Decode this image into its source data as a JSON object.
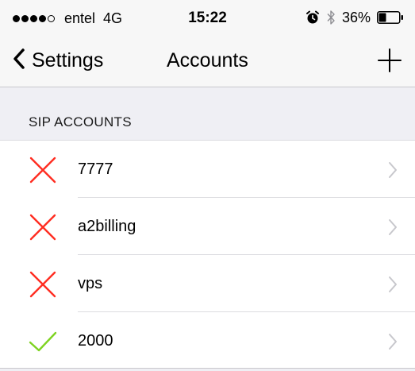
{
  "status_bar": {
    "carrier": "entel",
    "network": "4G",
    "time": "15:22",
    "battery": "36%",
    "battery_level": 0.36,
    "signal_bars_filled": 4,
    "signal_bars_total": 5,
    "icons": [
      "signal-icon",
      "alarm-icon",
      "bluetooth-icon",
      "battery-icon"
    ]
  },
  "nav": {
    "back_label": "Settings",
    "title": "Accounts",
    "add_icon": "plus-icon"
  },
  "section": {
    "title": "SIP ACCOUNTS"
  },
  "accounts": [
    {
      "label": "7777",
      "status": "error",
      "status_icon": "cross-icon"
    },
    {
      "label": "a2billing",
      "status": "error",
      "status_icon": "cross-icon"
    },
    {
      "label": "vps",
      "status": "error",
      "status_icon": "cross-icon"
    },
    {
      "label": "2000",
      "status": "ok",
      "status_icon": "check-icon"
    }
  ],
  "colors": {
    "error": "#ff2d21",
    "ok": "#7ed321",
    "chevron": "#c7c7cc",
    "background": "#efeff4"
  }
}
